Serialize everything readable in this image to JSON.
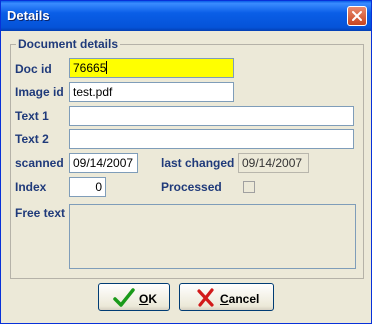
{
  "window": {
    "title": "Details"
  },
  "group": {
    "title": "Document details"
  },
  "fields": {
    "doc_id": {
      "label": "Doc id",
      "value": "76665"
    },
    "image_id": {
      "label": "Image id",
      "value": "test.pdf"
    },
    "text1": {
      "label": "Text 1",
      "value": ""
    },
    "text2": {
      "label": "Text 2",
      "value": ""
    },
    "scanned": {
      "label": "scanned",
      "value": "09/14/2007"
    },
    "last_changed": {
      "label": "last changed",
      "value": "09/14/2007"
    },
    "index": {
      "label": "Index",
      "value": "0"
    },
    "processed": {
      "label": "Processed",
      "checked": false
    },
    "free_text": {
      "label": "Free text",
      "value": ""
    }
  },
  "buttons": {
    "ok": {
      "first": "O",
      "rest": "K"
    },
    "cancel": {
      "first": "C",
      "rest": "ancel"
    }
  },
  "colors": {
    "title_bar": "#0a5ee7",
    "highlight": "#ffff00",
    "label": "#1f3a7a"
  }
}
